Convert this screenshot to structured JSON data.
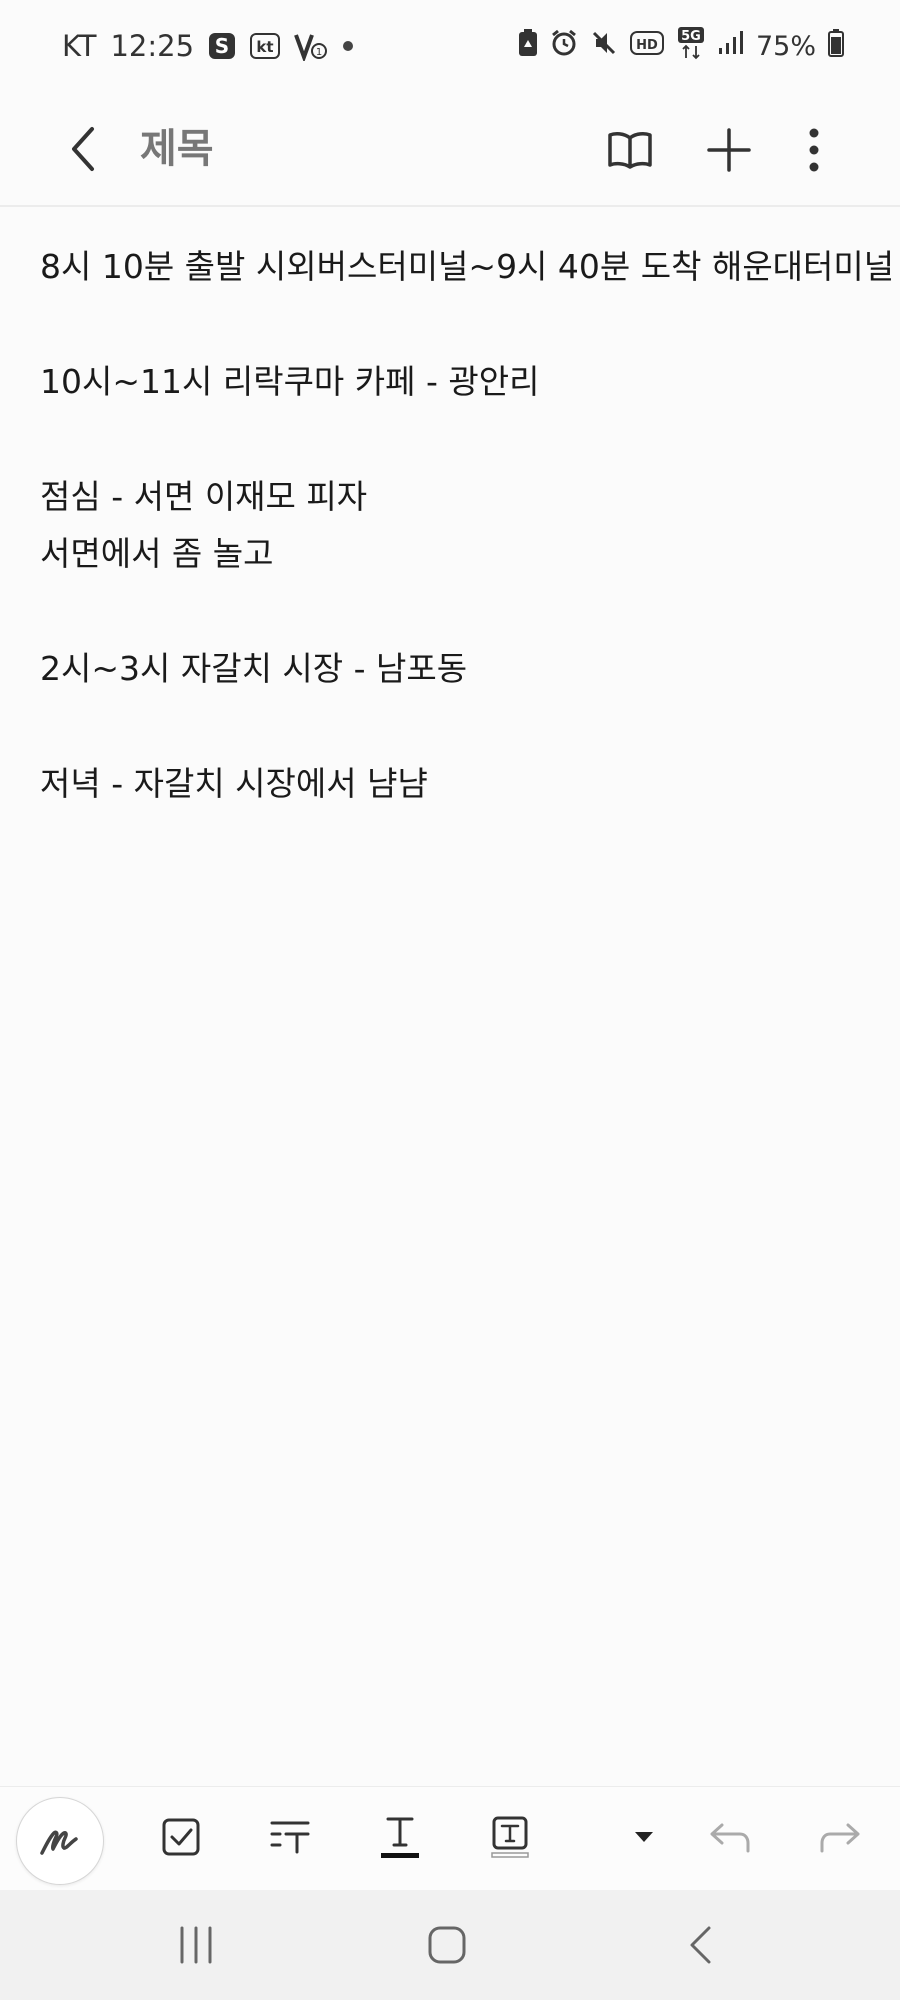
{
  "status_bar": {
    "carrier": "KT",
    "time": "12:25",
    "notif_icons": [
      "samsung-s-icon",
      "kt-icon",
      "v-one-icon",
      "dot-icon"
    ],
    "sys_icons": [
      "battery-saver-icon",
      "alarm-icon",
      "mute-icon",
      "hd-icon",
      "5g-icon",
      "signal-icon"
    ],
    "network_label": "5G",
    "hd_label": "HD",
    "battery_percent": "75%",
    "battery_level": 0.75
  },
  "header": {
    "title": "제목",
    "actions": [
      "book-icon",
      "plus-icon",
      "more-vert-icon"
    ]
  },
  "note": {
    "lines": [
      "8시 10분 출발 시외버스터미널~9시 40분 도착 해운대터미널",
      "10시~11시 리락쿠마 카페 - 광안리",
      "점심 - 서면 이재모 피자",
      "서면에서 좀 놀고",
      "2시~3시 자갈치 시장 - 남포동",
      "저녁 - 자갈치 시장에서 냠냠"
    ]
  },
  "toolbar": {
    "tools": [
      "pen-icon",
      "checkbox-icon",
      "text-format-icon",
      "text-color-icon",
      "text-box-icon",
      "dropdown-icon",
      "undo-icon",
      "redo-icon"
    ]
  },
  "nav_bar": {
    "buttons": [
      "recents-icon",
      "home-icon",
      "back-icon"
    ]
  },
  "colors": {
    "background": "#fbfbfb",
    "title_gray": "#777777",
    "text": "#1a1a1a",
    "nav_bg": "#f1f1f1"
  }
}
